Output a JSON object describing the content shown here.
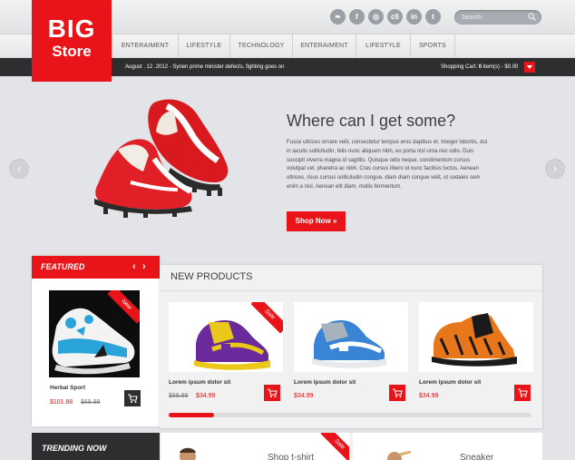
{
  "logo": {
    "line1": "BIG",
    "line2": "Store"
  },
  "social": [
    {
      "icon": "twitter-icon",
      "glyph": "❧"
    },
    {
      "icon": "facebook-icon",
      "glyph": "f"
    },
    {
      "icon": "dribbble-icon",
      "glyph": "◎"
    },
    {
      "icon": "flickr-icon",
      "glyph": "c6"
    },
    {
      "icon": "linkedin-icon",
      "glyph": "in"
    },
    {
      "icon": "tumblr-icon",
      "glyph": "t"
    }
  ],
  "search": {
    "placeholder": "Search"
  },
  "nav": [
    "ENTERAIMENT",
    "LIFESTYLE",
    "TECHNOLOGY",
    "ENTERAIMENT",
    "LIFESTYLE",
    "SPORTS"
  ],
  "ticker": "August . 12 .2012 - Syrien prime minister defects, fighting goes on",
  "cart": {
    "text": "Shopping Cart:",
    "count": "0",
    "suffix": "item(s) - $0.00"
  },
  "hero": {
    "title": "Where can I get some?",
    "text": "Fusce ultrices ornare velit, consectetur tempus eros dapibus et. Integer lobortis, dui in iaculis sollicitudin, felis nunc aliquam nibh, eu porta nisl urna nec odio. Duis suscipit viverra magna id sagittis. Quisque odio neque, condimentum cursus volutpat vel, pharetra ac nibh. Cras cursus libero id nunc facilisis luctus. Aenean ultrices, risus cursus sollicitudin congue, diam diam congue velit, ut sodales sem enim a nisl. Aenean elit diam, mollis fermentum.",
    "button": "Shop Now »",
    "prev": "‹",
    "next": "›"
  },
  "featured": {
    "title": "FEATURED",
    "prev": "‹",
    "next": "›",
    "ribbon": "New",
    "name": "Herbal Sport",
    "price": "$101.88",
    "old_price": "$69.99"
  },
  "new_products": {
    "title": "NEW PRODUCTS",
    "items": [
      {
        "ribbon": "Sale",
        "name": "Lorem ipsum dolor sit",
        "old_price": "$69.99",
        "price": "$34.99"
      },
      {
        "ribbon": "",
        "name": "Lorem ipsum dolor sit",
        "old_price": "",
        "price": "$34.99"
      },
      {
        "ribbon": "",
        "name": "Lorem ipsum dolor sit",
        "old_price": "",
        "price": "$34.99"
      }
    ]
  },
  "trending": {
    "title": "TRENDING NOW",
    "items": [
      {
        "label": "Shop t-shirt",
        "ribbon": "Sale"
      },
      {
        "label": "Sneaker",
        "ribbon": ""
      }
    ]
  },
  "colors": {
    "accent": "#e8141a",
    "dark": "#2d2e30",
    "background": "#e3e4e7"
  }
}
